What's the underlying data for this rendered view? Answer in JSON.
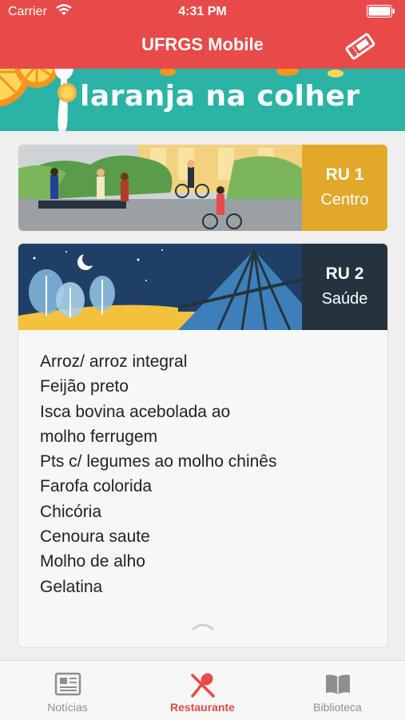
{
  "status_bar": {
    "carrier": "Carrier",
    "time": "4:31 PM"
  },
  "nav": {
    "title": "UFRGS Mobile",
    "ticket_icon": "ticket-icon"
  },
  "banner": {
    "text": "laranja na colher"
  },
  "restaurants": [
    {
      "name": "RU 1",
      "location": "Centro",
      "color": "#e2a82a"
    },
    {
      "name": "RU 2",
      "location": "Saúde",
      "color": "#24333d"
    }
  ],
  "menu_items": [
    "Arroz/ arroz integral",
    "Feijão preto",
    "Isca bovina acebolada ao",
    "molho ferrugem",
    "Pts c/ legumes ao molho chinês",
    "Farofa colorida",
    "Chicória",
    "Cenoura saute",
    "Molho de alho",
    "Gelatina"
  ],
  "tabs": [
    {
      "label": "Notícias",
      "icon": "newspaper-icon",
      "active": false
    },
    {
      "label": "Restaurante",
      "icon": "fork-spoon-icon",
      "active": true
    },
    {
      "label": "Biblioteca",
      "icon": "book-icon",
      "active": false
    }
  ],
  "colors": {
    "brand": "#e84a4a",
    "banner": "#2bb3a5",
    "inactive_tab": "#8e8e8e"
  }
}
